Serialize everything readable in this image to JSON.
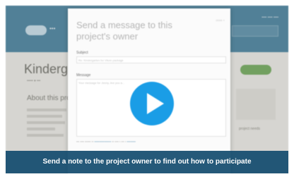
{
  "modal": {
    "title": "Send a message to this project's owner",
    "subject_label": "Subject",
    "subject_placeholder": "Re: Kindergarten for Vilure package",
    "message_label": "Message",
    "message_placeholder": "Your message for Jenny. Are you a..."
  },
  "background": {
    "page_title": "Kindergar"
  },
  "banner": {
    "text": "Send a note to the project owner to find out how to participate"
  },
  "colors": {
    "banner": "#124b6e",
    "play_button": "#1a9de6",
    "header": "#5b8fa9"
  },
  "icons": {
    "play": "play-icon"
  }
}
